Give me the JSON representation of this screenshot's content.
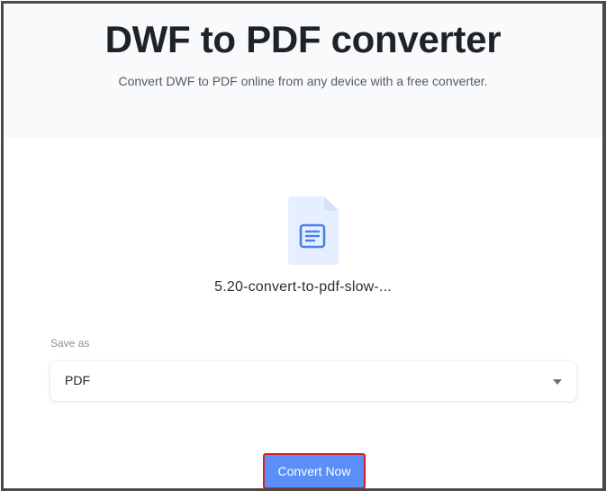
{
  "header": {
    "title": "DWF to PDF converter",
    "subtitle": "Convert DWF to PDF online from any device with a free converter."
  },
  "file": {
    "name": "5.20-convert-to-pdf-slow-...",
    "icon": "document-icon"
  },
  "save_as": {
    "label": "Save as",
    "selected": "PDF"
  },
  "actions": {
    "convert_label": "Convert Now"
  },
  "colors": {
    "accent": "#5b8ef7",
    "highlight_border": "#d0202b",
    "file_icon_bg": "#e6efff",
    "file_icon_glyph": "#4a7fe8"
  }
}
